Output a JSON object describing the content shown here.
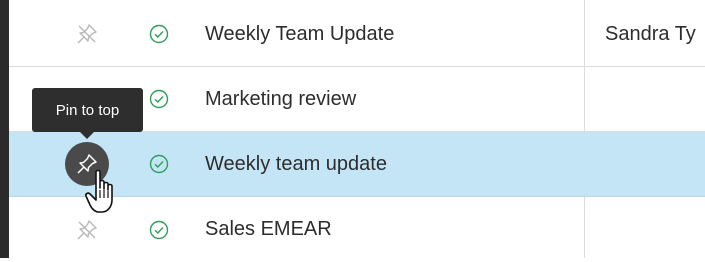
{
  "colors": {
    "check_green": "#2e9e5b",
    "selected_row": "#c4e5f6",
    "tooltip_bg": "#2e2e2e"
  },
  "tooltip": {
    "text": "Pin to top"
  },
  "rows": [
    {
      "title": "Weekly Team Update",
      "owner": "Sandra Ty",
      "status_icon": "check-circle-icon",
      "pin_icon": "unpin-icon"
    },
    {
      "title": "Marketing review",
      "owner": "",
      "status_icon": "check-circle-icon",
      "pin_icon": "unpin-icon"
    },
    {
      "title": "Weekly team update",
      "owner": "",
      "status_icon": "check-circle-icon",
      "pin_icon": "pin-icon",
      "selected": true
    },
    {
      "title": "Sales EMEAR",
      "owner": "",
      "status_icon": "check-circle-icon",
      "pin_icon": "unpin-icon"
    }
  ]
}
